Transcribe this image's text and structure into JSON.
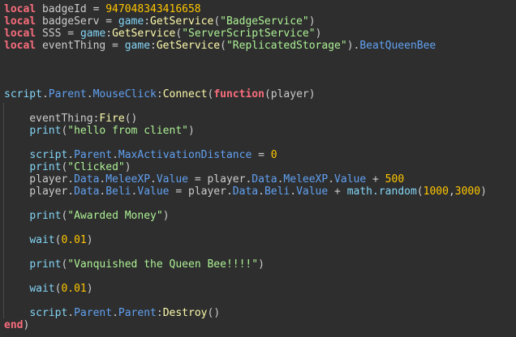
{
  "lines": [
    [
      [
        "kw",
        "local"
      ],
      [
        "id",
        " badgeId = "
      ],
      [
        "num",
        "947048343416658"
      ]
    ],
    [
      [
        "kw",
        "local"
      ],
      [
        "id",
        " badgeServ = "
      ],
      [
        "bi",
        "game"
      ],
      [
        "id",
        ":"
      ],
      [
        "fn",
        "GetService"
      ],
      [
        "id",
        "("
      ],
      [
        "str",
        "\"BadgeService\""
      ],
      [
        "id",
        ")"
      ]
    ],
    [
      [
        "kw",
        "local"
      ],
      [
        "id",
        " SSS = "
      ],
      [
        "bi",
        "game"
      ],
      [
        "id",
        ":"
      ],
      [
        "fn",
        "GetService"
      ],
      [
        "id",
        "("
      ],
      [
        "str",
        "\"ServerScriptService\""
      ],
      [
        "id",
        ")"
      ]
    ],
    [
      [
        "kw",
        "local"
      ],
      [
        "id",
        " eventThing = "
      ],
      [
        "bi",
        "game"
      ],
      [
        "id",
        ":"
      ],
      [
        "fn",
        "GetService"
      ],
      [
        "id",
        "("
      ],
      [
        "str",
        "\"ReplicatedStorage\""
      ],
      [
        "id",
        ")."
      ],
      [
        "mem",
        "BeatQueenBee"
      ]
    ],
    [],
    [],
    [],
    [
      [
        "bi",
        "script"
      ],
      [
        "id",
        "."
      ],
      [
        "mem",
        "Parent"
      ],
      [
        "id",
        "."
      ],
      [
        "mem",
        "MouseClick"
      ],
      [
        "id",
        ":"
      ],
      [
        "fn",
        "Connect"
      ],
      [
        "id",
        "("
      ],
      [
        "kw",
        "function"
      ],
      [
        "id",
        "(player)"
      ]
    ],
    [],
    [
      [
        "id",
        "    eventThing:"
      ],
      [
        "fn",
        "Fire"
      ],
      [
        "id",
        "()"
      ]
    ],
    [
      [
        "id",
        "    "
      ],
      [
        "bi",
        "print"
      ],
      [
        "id",
        "("
      ],
      [
        "str",
        "\"hello from client\""
      ],
      [
        "id",
        ")"
      ]
    ],
    [],
    [
      [
        "id",
        "    "
      ],
      [
        "bi",
        "script"
      ],
      [
        "id",
        "."
      ],
      [
        "mem",
        "Parent"
      ],
      [
        "id",
        "."
      ],
      [
        "mem",
        "MaxActivationDistance"
      ],
      [
        "id",
        " = "
      ],
      [
        "num",
        "0"
      ]
    ],
    [
      [
        "id",
        "    "
      ],
      [
        "bi",
        "print"
      ],
      [
        "id",
        "("
      ],
      [
        "str",
        "\"Clicked\""
      ],
      [
        "id",
        ")"
      ]
    ],
    [
      [
        "id",
        "    player."
      ],
      [
        "mem",
        "Data"
      ],
      [
        "id",
        "."
      ],
      [
        "mem",
        "MeleeXP"
      ],
      [
        "id",
        "."
      ],
      [
        "mem",
        "Value"
      ],
      [
        "id",
        " = player."
      ],
      [
        "mem",
        "Data"
      ],
      [
        "id",
        "."
      ],
      [
        "mem",
        "MeleeXP"
      ],
      [
        "id",
        "."
      ],
      [
        "mem",
        "Value"
      ],
      [
        "id",
        " + "
      ],
      [
        "num",
        "500"
      ]
    ],
    [
      [
        "id",
        "    player."
      ],
      [
        "mem",
        "Data"
      ],
      [
        "id",
        "."
      ],
      [
        "mem",
        "Beli"
      ],
      [
        "id",
        "."
      ],
      [
        "mem",
        "Value"
      ],
      [
        "id",
        " = player."
      ],
      [
        "mem",
        "Data"
      ],
      [
        "id",
        "."
      ],
      [
        "mem",
        "Beli"
      ],
      [
        "id",
        "."
      ],
      [
        "mem",
        "Value"
      ],
      [
        "id",
        " + "
      ],
      [
        "bi",
        "math.random"
      ],
      [
        "id",
        "("
      ],
      [
        "num",
        "1000"
      ],
      [
        "id",
        ","
      ],
      [
        "num",
        "3000"
      ],
      [
        "id",
        ")"
      ]
    ],
    [],
    [
      [
        "id",
        "    "
      ],
      [
        "bi",
        "print"
      ],
      [
        "id",
        "("
      ],
      [
        "str",
        "\"Awarded Money\""
      ],
      [
        "id",
        ")"
      ]
    ],
    [],
    [
      [
        "id",
        "    "
      ],
      [
        "bi",
        "wait"
      ],
      [
        "id",
        "("
      ],
      [
        "num",
        "0.01"
      ],
      [
        "id",
        ")"
      ]
    ],
    [],
    [
      [
        "id",
        "    "
      ],
      [
        "bi",
        "print"
      ],
      [
        "id",
        "("
      ],
      [
        "str",
        "\"Vanquished the Queen Bee!!!!\""
      ],
      [
        "id",
        ")"
      ]
    ],
    [],
    [
      [
        "id",
        "    "
      ],
      [
        "bi",
        "wait"
      ],
      [
        "id",
        "("
      ],
      [
        "num",
        "0.01"
      ],
      [
        "id",
        ")"
      ]
    ],
    [],
    [
      [
        "id",
        "    "
      ],
      [
        "bi",
        "script"
      ],
      [
        "id",
        "."
      ],
      [
        "mem",
        "Parent"
      ],
      [
        "id",
        "."
      ],
      [
        "mem",
        "Parent"
      ],
      [
        "id",
        ":"
      ],
      [
        "fn",
        "Destroy"
      ],
      [
        "id",
        "()"
      ]
    ],
    [
      [
        "kw",
        "end"
      ],
      [
        "id",
        ")"
      ]
    ]
  ]
}
